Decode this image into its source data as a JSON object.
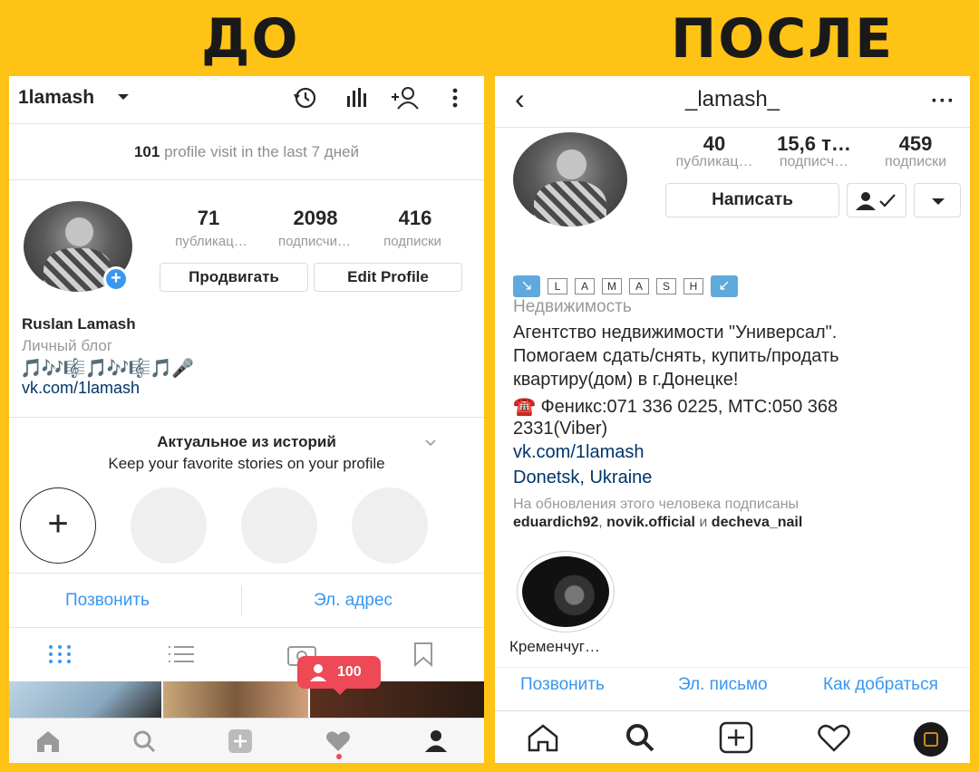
{
  "titles": {
    "before": "ДО",
    "after": "ПОСЛЕ"
  },
  "left": {
    "username": "1lamash",
    "visits_count": "101",
    "visits_text": "profile visit in the last 7 дней",
    "stats": [
      {
        "value": "71",
        "label": "публикац…"
      },
      {
        "value": "2098",
        "label": "подписчи…"
      },
      {
        "value": "416",
        "label": "подписки"
      }
    ],
    "promote_button": "Продвигать",
    "edit_button": "Edit Profile",
    "name": "Ruslan Lamash",
    "category": "Личный блог",
    "emoji_line": "🎵🎶🎼🎵🎶🎼🎵🎤",
    "link": "vk.com/1lamash",
    "highlights_title": "Актуальное из историй",
    "highlights_sub": "Keep your favorite stories on your profile",
    "call_button": "Позвонить",
    "email_button": "Эл. адрес",
    "notification_count": "100"
  },
  "right": {
    "username": "_lamash_",
    "stats": [
      {
        "value": "40",
        "label": "публикац…"
      },
      {
        "value": "15,6 т…",
        "label": "подписч…"
      },
      {
        "value": "459",
        "label": "подписки"
      }
    ],
    "message_button": "Написать",
    "name_letters": [
      "L",
      "A",
      "M",
      "A",
      "S",
      "H"
    ],
    "category": "Недвижимость",
    "bio_line1": "Агентство недвижимости \"Универсал\".",
    "bio_line2": "Помогаем сдать/снять, купить/продать",
    "bio_line3": "квартиру(дом) в г.Донецке!",
    "phone_line1": "☎️ Феникс:071 336 0225, МТС:050 368",
    "phone_line2": "2331(Viber)",
    "link": "vk.com/1lamash",
    "location": "Donetsk, Ukraine",
    "followed_by_text": "На обновления этого человека подписаны",
    "follower1": "eduardich92",
    "follower2": "novik.official",
    "and_text": "и",
    "follower3": "decheva_nail",
    "story_label": "Кременчуг…",
    "call_button": "Позвонить",
    "email_button": "Эл. письмо",
    "directions_button": "Как добраться"
  }
}
